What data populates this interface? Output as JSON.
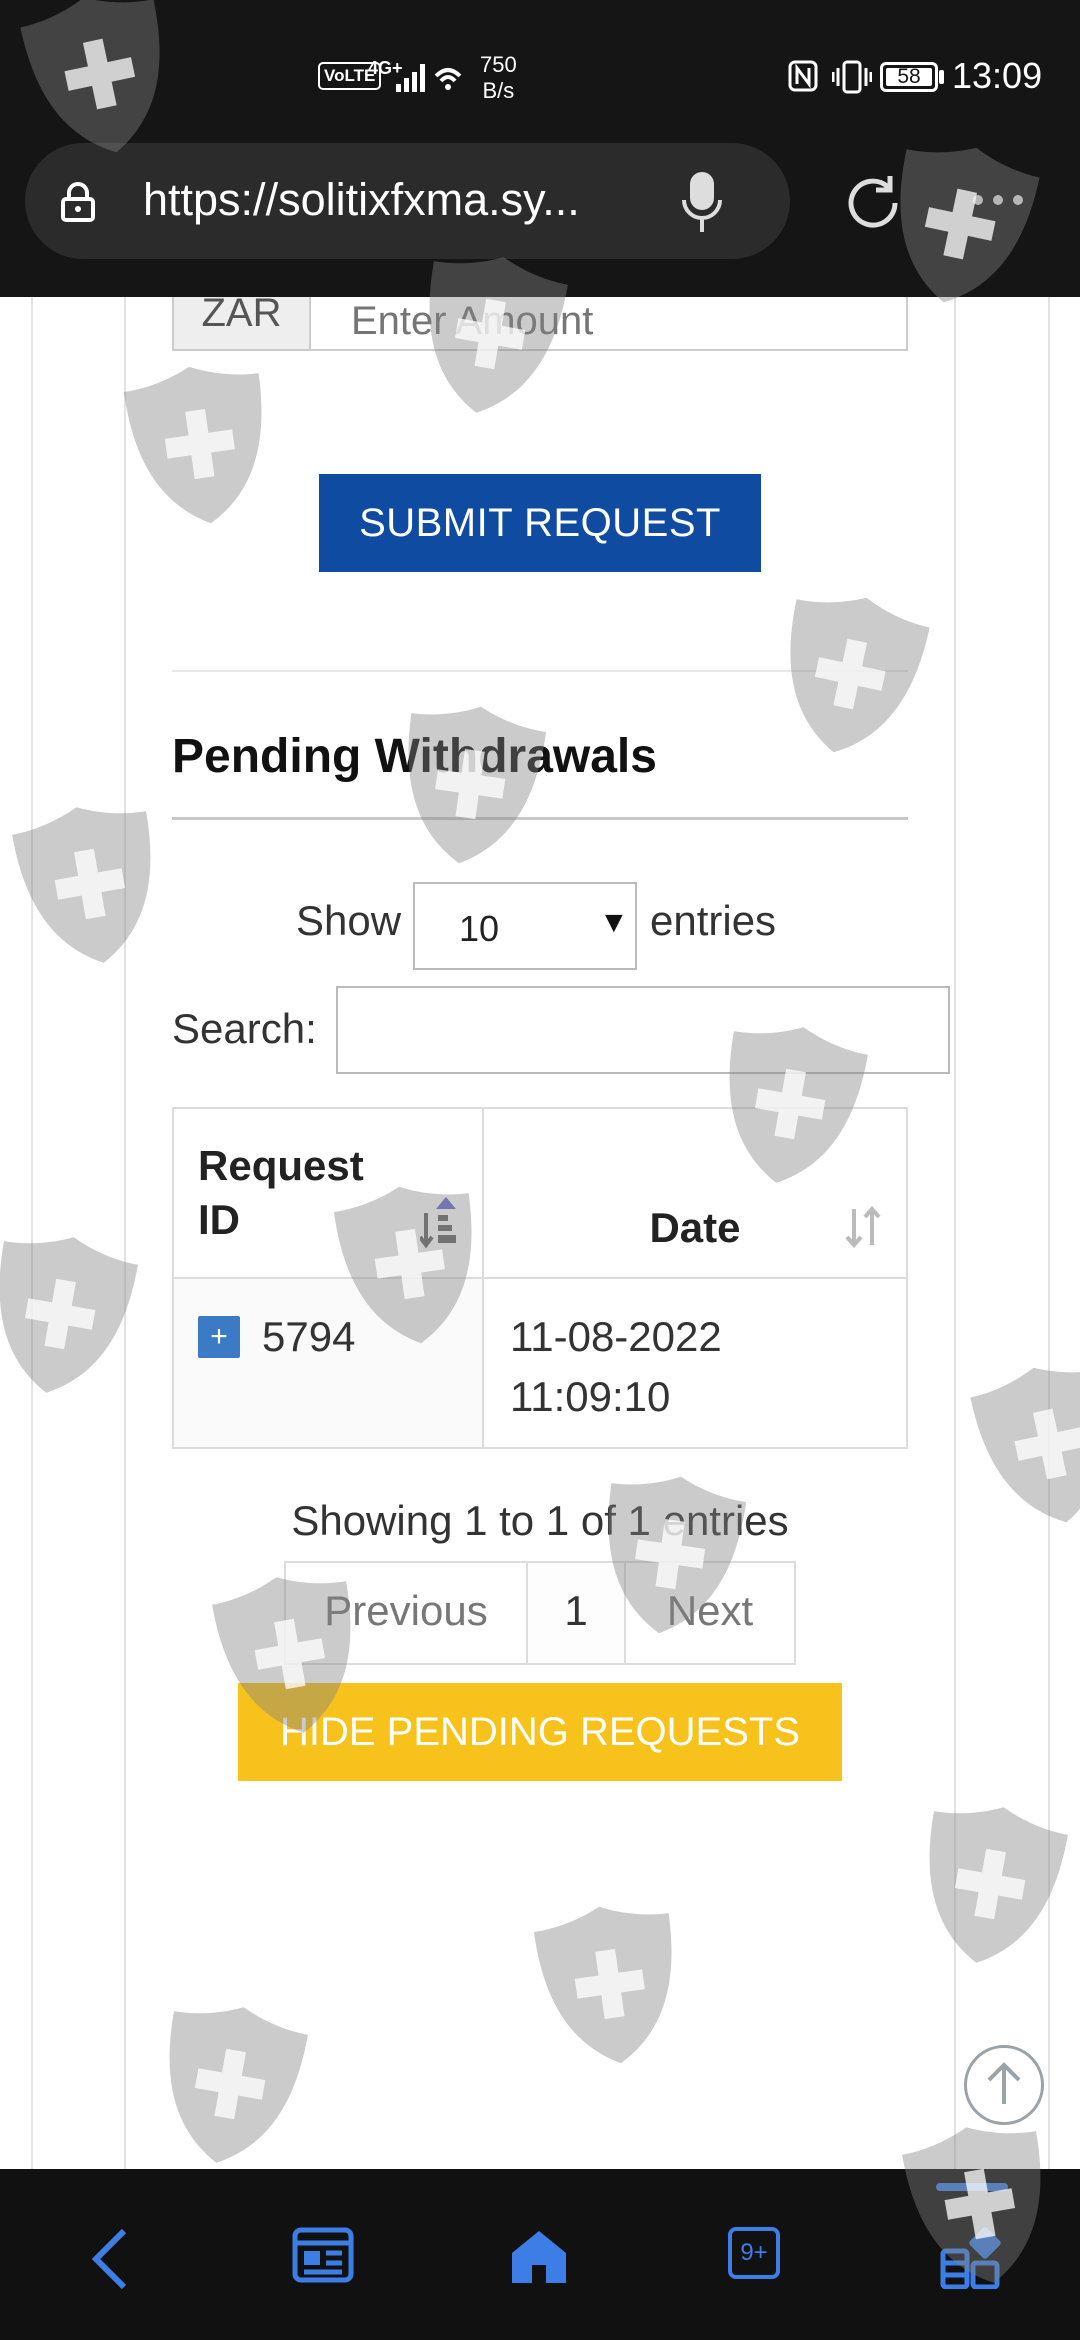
{
  "status_bar": {
    "volte": "VoLTE",
    "network": "4G+",
    "net_speed_value": "750",
    "net_speed_unit": "B/s",
    "battery": "58",
    "time": "13:09"
  },
  "browser": {
    "url": "https://solitixfxma.sy..."
  },
  "form": {
    "currency_addon": "ZAR",
    "amount_placeholder": "Enter Amount",
    "submit_label": "SUBMIT REQUEST"
  },
  "pending": {
    "title": "Pending Withdrawals",
    "show_label": "Show",
    "page_size": "10",
    "entries_label": "entries",
    "search_label": "Search:",
    "search_value": "",
    "columns": [
      "Request ID",
      "Date"
    ],
    "rows": [
      {
        "expand": "+",
        "id": "5794",
        "date": "11-08-2022",
        "time": "11:09:10"
      }
    ],
    "info": "Showing 1 to 1 of 1 entries",
    "pagination": {
      "previous": "Previous",
      "current": "1",
      "next": "Next"
    },
    "hide_label": "HIDE PENDING REQUESTS"
  },
  "bottom_nav": {
    "tabs_count": "9+"
  },
  "colors": {
    "submit": "#0f4ba1",
    "hide": "#f7c21b",
    "expand": "#3b7bc5",
    "nav_accent": "#3d7ee6"
  },
  "icons": [
    "lock-icon",
    "mic-icon",
    "reload-icon",
    "more-icon",
    "arrow-up-icon",
    "back-icon",
    "news-icon",
    "home-icon",
    "tabs-icon",
    "apps-icon",
    "sort-icon",
    "shield-watermark-icon"
  ]
}
